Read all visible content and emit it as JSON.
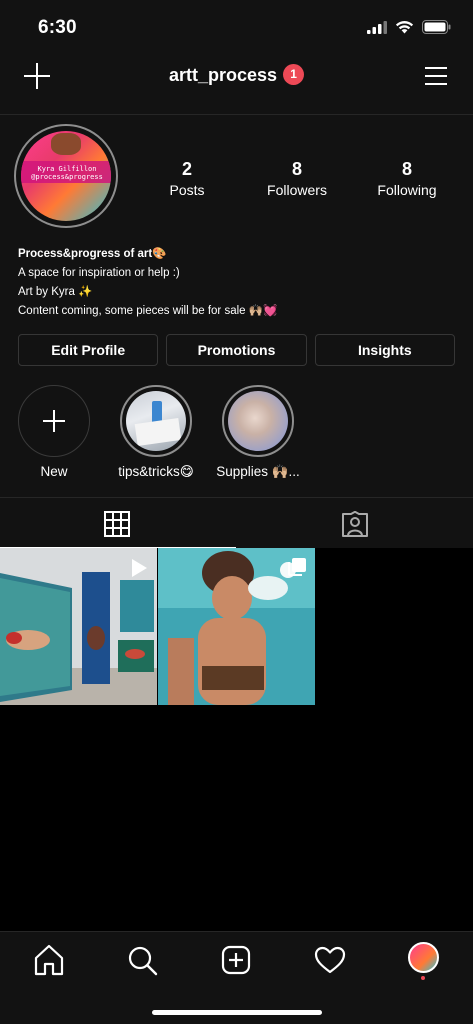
{
  "status_bar": {
    "time": "6:30"
  },
  "header": {
    "username": "artt_process",
    "notification_count": "1"
  },
  "profile": {
    "avatar_text_line1": "Kyra Gilfillon",
    "avatar_text_line2": "@process&progress",
    "stats": [
      {
        "value": "2",
        "label": "Posts"
      },
      {
        "value": "8",
        "label": "Followers"
      },
      {
        "value": "8",
        "label": "Following"
      }
    ],
    "bio": {
      "name": "Process&progress of art🎨",
      "line1": "A space for inspiration or help :)",
      "line2": "Art by Kyra ✨",
      "line3": "Content coming, some pieces will be for sale 🙌🏼💓"
    },
    "buttons": {
      "edit": "Edit Profile",
      "promotions": "Promotions",
      "insights": "Insights"
    }
  },
  "highlights": [
    {
      "label": "New"
    },
    {
      "label": "tips&tricks😋"
    },
    {
      "label": "Supplies 🙌🏼..."
    }
  ],
  "tabs": [
    {
      "icon": "grid-icon",
      "active": true
    },
    {
      "icon": "tagged-icon",
      "active": false
    }
  ],
  "posts": [
    {
      "type": "video",
      "icon": "play-icon"
    },
    {
      "type": "carousel",
      "icon": "carousel-icon"
    }
  ],
  "navbar": [
    "home-icon",
    "search-icon",
    "new-post-icon",
    "activity-icon",
    "profile-avatar"
  ],
  "colors": {
    "background": "#000000",
    "surface": "#121212",
    "badge": "#ed4956",
    "border": "#363636"
  }
}
